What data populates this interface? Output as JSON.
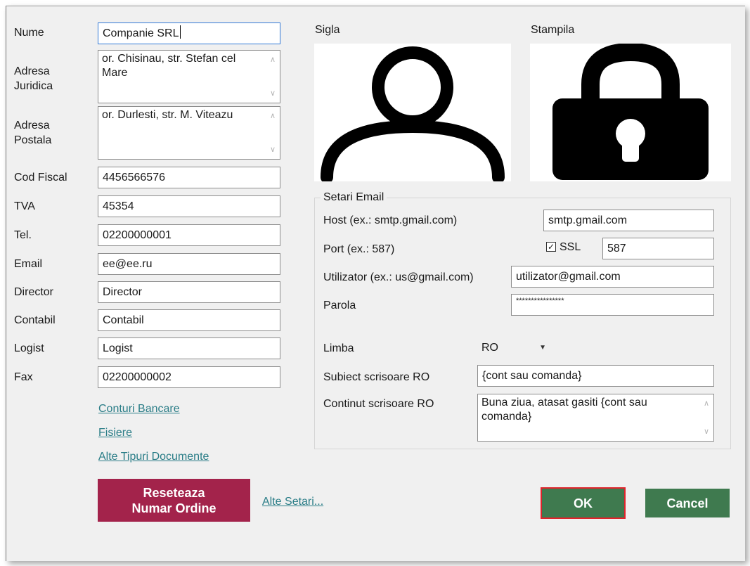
{
  "company": {
    "fields": [
      {
        "key": "nume",
        "label": "Nume",
        "value": "Companie SRL"
      },
      {
        "key": "cod_fiscal",
        "label": "Cod Fiscal",
        "value": "4456566576"
      },
      {
        "key": "tva",
        "label": "TVA",
        "value": "45354"
      },
      {
        "key": "tel",
        "label": "Tel.",
        "value": "02200000001"
      },
      {
        "key": "email",
        "label": "Email",
        "value": "ee@ee.ru"
      },
      {
        "key": "director",
        "label": "Director",
        "value": "Director"
      },
      {
        "key": "contabil",
        "label": "Contabil",
        "value": "Contabil"
      },
      {
        "key": "logist",
        "label": "Logist",
        "value": "Logist"
      },
      {
        "key": "fax",
        "label": "Fax",
        "value": "02200000002"
      }
    ],
    "adresa_juridica": {
      "label_line1": "Adresa",
      "label_line2": "Juridica",
      "value": "or. Chisinau, str. Stefan cel Mare"
    },
    "adresa_postala": {
      "label_line1": "Adresa",
      "label_line2": "Postala",
      "value": "or. Durlesti, str. M. Viteazu"
    }
  },
  "links": {
    "conturi": "Conturi Bancare",
    "fisiere": "Fisiere",
    "alte_tipuri": "Alte Tipuri Documente",
    "alte_setari": "Alte Setari..."
  },
  "images": {
    "sigla_label": "Sigla",
    "stampila_label": "Stampila",
    "sigla_icon": "user-icon",
    "stampila_icon": "lock-icon"
  },
  "email_settings": {
    "title": "Setari Email",
    "host_label": "Host (ex.: smtp.gmail.com)",
    "host_value": "smtp.gmail.com",
    "port_label": "Port (ex.: 587)",
    "ssl_label": "SSL",
    "ssl_checked": true,
    "port_value": "587",
    "user_label": "Utilizator (ex.: us@gmail.com)",
    "user_value": "utilizator@gmail.com",
    "password_label": "Parola",
    "password_value": "****************",
    "language_label": "Limba",
    "language_value": "RO",
    "subject_label": "Subiect scrisoare RO",
    "subject_value": "{cont sau comanda}",
    "body_label": "Continut scrisoare RO",
    "body_value": "Buna ziua, atasat gasiti {cont sau comanda}"
  },
  "buttons": {
    "reset_line1": "Reseteaza",
    "reset_line2": "Numar Ordine",
    "ok": "OK",
    "cancel": "Cancel"
  },
  "colors": {
    "reset_button": "#a3234b",
    "ok_button": "#3f7a4f",
    "ok_border": "#e0232b",
    "cancel_button": "#3f7a4f",
    "link": "#2a7d87"
  }
}
